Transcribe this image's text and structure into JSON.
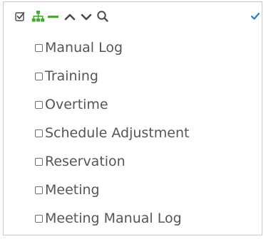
{
  "toolbar": {
    "icons": [
      "checkbox-all-icon",
      "hierarchy-icon",
      "minus-icon",
      "chevron-up-icon",
      "chevron-down-icon",
      "search-icon",
      "checkmark-icon"
    ],
    "colors": {
      "green": "#3fae2a",
      "gray": "#4a4a4a",
      "blue": "#2b7bd6"
    }
  },
  "items": [
    {
      "label": "Manual Log"
    },
    {
      "label": "Training"
    },
    {
      "label": "Overtime"
    },
    {
      "label": "Schedule Adjustment"
    },
    {
      "label": "Reservation"
    },
    {
      "label": "Meeting"
    },
    {
      "label": "Meeting Manual Log"
    }
  ]
}
